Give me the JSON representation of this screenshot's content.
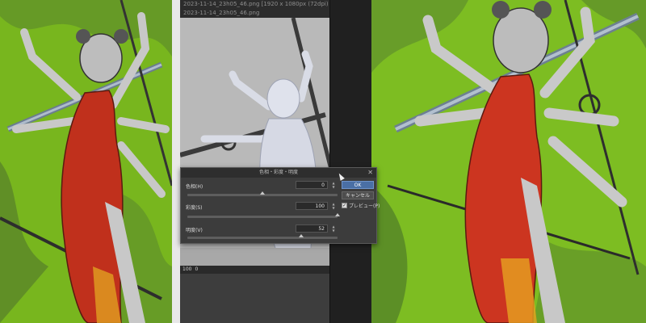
{
  "app": {
    "tab_title": "2023-11-14_23h05_46.png",
    "tab_title_full": "2023-11-14_23h05_46.png [1920 x 1080px (72dpi) 300.0%] : 29 Ë",
    "status": [
      "100",
      "0"
    ]
  },
  "dialog": {
    "title": "色相・彩度・明度",
    "hue_label": "色相(H)",
    "hue_value": "0",
    "hue_level": 0.5,
    "saturation_label": "彩度(S)",
    "saturation_value": "100",
    "saturation_level": 1.0,
    "lightness_label": "明度(V)",
    "lightness_value": "52",
    "lightness_level": 0.76,
    "ok_label": "OK",
    "cancel_label": "キャンセル",
    "preview_label": "プレビュー(P)",
    "preview_checked": true
  },
  "colors": {
    "canvas_green": "#78b61e",
    "dress_red": "#c0301c",
    "ok_blue": "#4a6fa5",
    "ui_dark": "#3a3a3a"
  }
}
